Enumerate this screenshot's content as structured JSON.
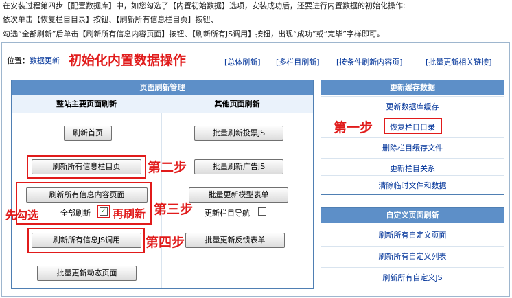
{
  "intro": {
    "line1": "在安装过程第四步【配置数据库】中，如您勾选了【内置初始数据】选项，安装成功后，还要进行内置数据的初始化操作:",
    "line2": "依次单击【恢复栏目目录】按钮、【刷新所有信息栏目页】按钮、",
    "line3": "勾选“全部刷新”后单击【刷新所有信息内容页面】按钮、【刷新所有JS调用】按钮，出现“成功”或“完毕”字样即可。"
  },
  "location": {
    "label": "位置：",
    "crumb": "数据更新",
    "title": "初始化内置数据操作"
  },
  "top_links": [
    "[总体刷新]",
    "[多栏目刷新]",
    "[按条件刷新内容页]",
    "[批量更新相关链接]"
  ],
  "page_refresh": {
    "title": "页面刷新管理",
    "col1_title": "整站主要页面刷新",
    "col2_title": "其他页面刷新",
    "left_buttons": [
      "刷新首页",
      "刷新所有信息栏目页",
      "刷新所有信息内容页面",
      "刷新所有信息JS调用",
      "批量更新动态页面"
    ],
    "right_buttons": [
      "批量刷新投票JS",
      "批量刷新广告JS",
      "批量更新模型表单",
      "批量更新反馈表单"
    ],
    "all_refresh_label": "全部刷新",
    "nav_label": "更新栏目导航"
  },
  "steps": {
    "first": "第一步",
    "second": "第二步",
    "third": "第三步",
    "fourth": "第四步",
    "check_first": "先勾选",
    "refresh_again": "再刷新"
  },
  "cache": {
    "title": "更新缓存数据",
    "items": [
      "更新数据库缓存",
      "恢复栏目目录",
      "删除栏目缓存文件",
      "更新栏目关系",
      "清除临时文件和数据"
    ]
  },
  "custom": {
    "title": "自定义页面刷新",
    "items": [
      "刷新所有自定义页面",
      "刷新所有自定义列表",
      "刷新所有自定义JS"
    ]
  },
  "colors": {
    "accent": "#5d8fc8",
    "highlight": "#e11b1b",
    "link": "#003399"
  },
  "checkbox_states": {
    "all_refresh": true,
    "nav_update": false
  }
}
